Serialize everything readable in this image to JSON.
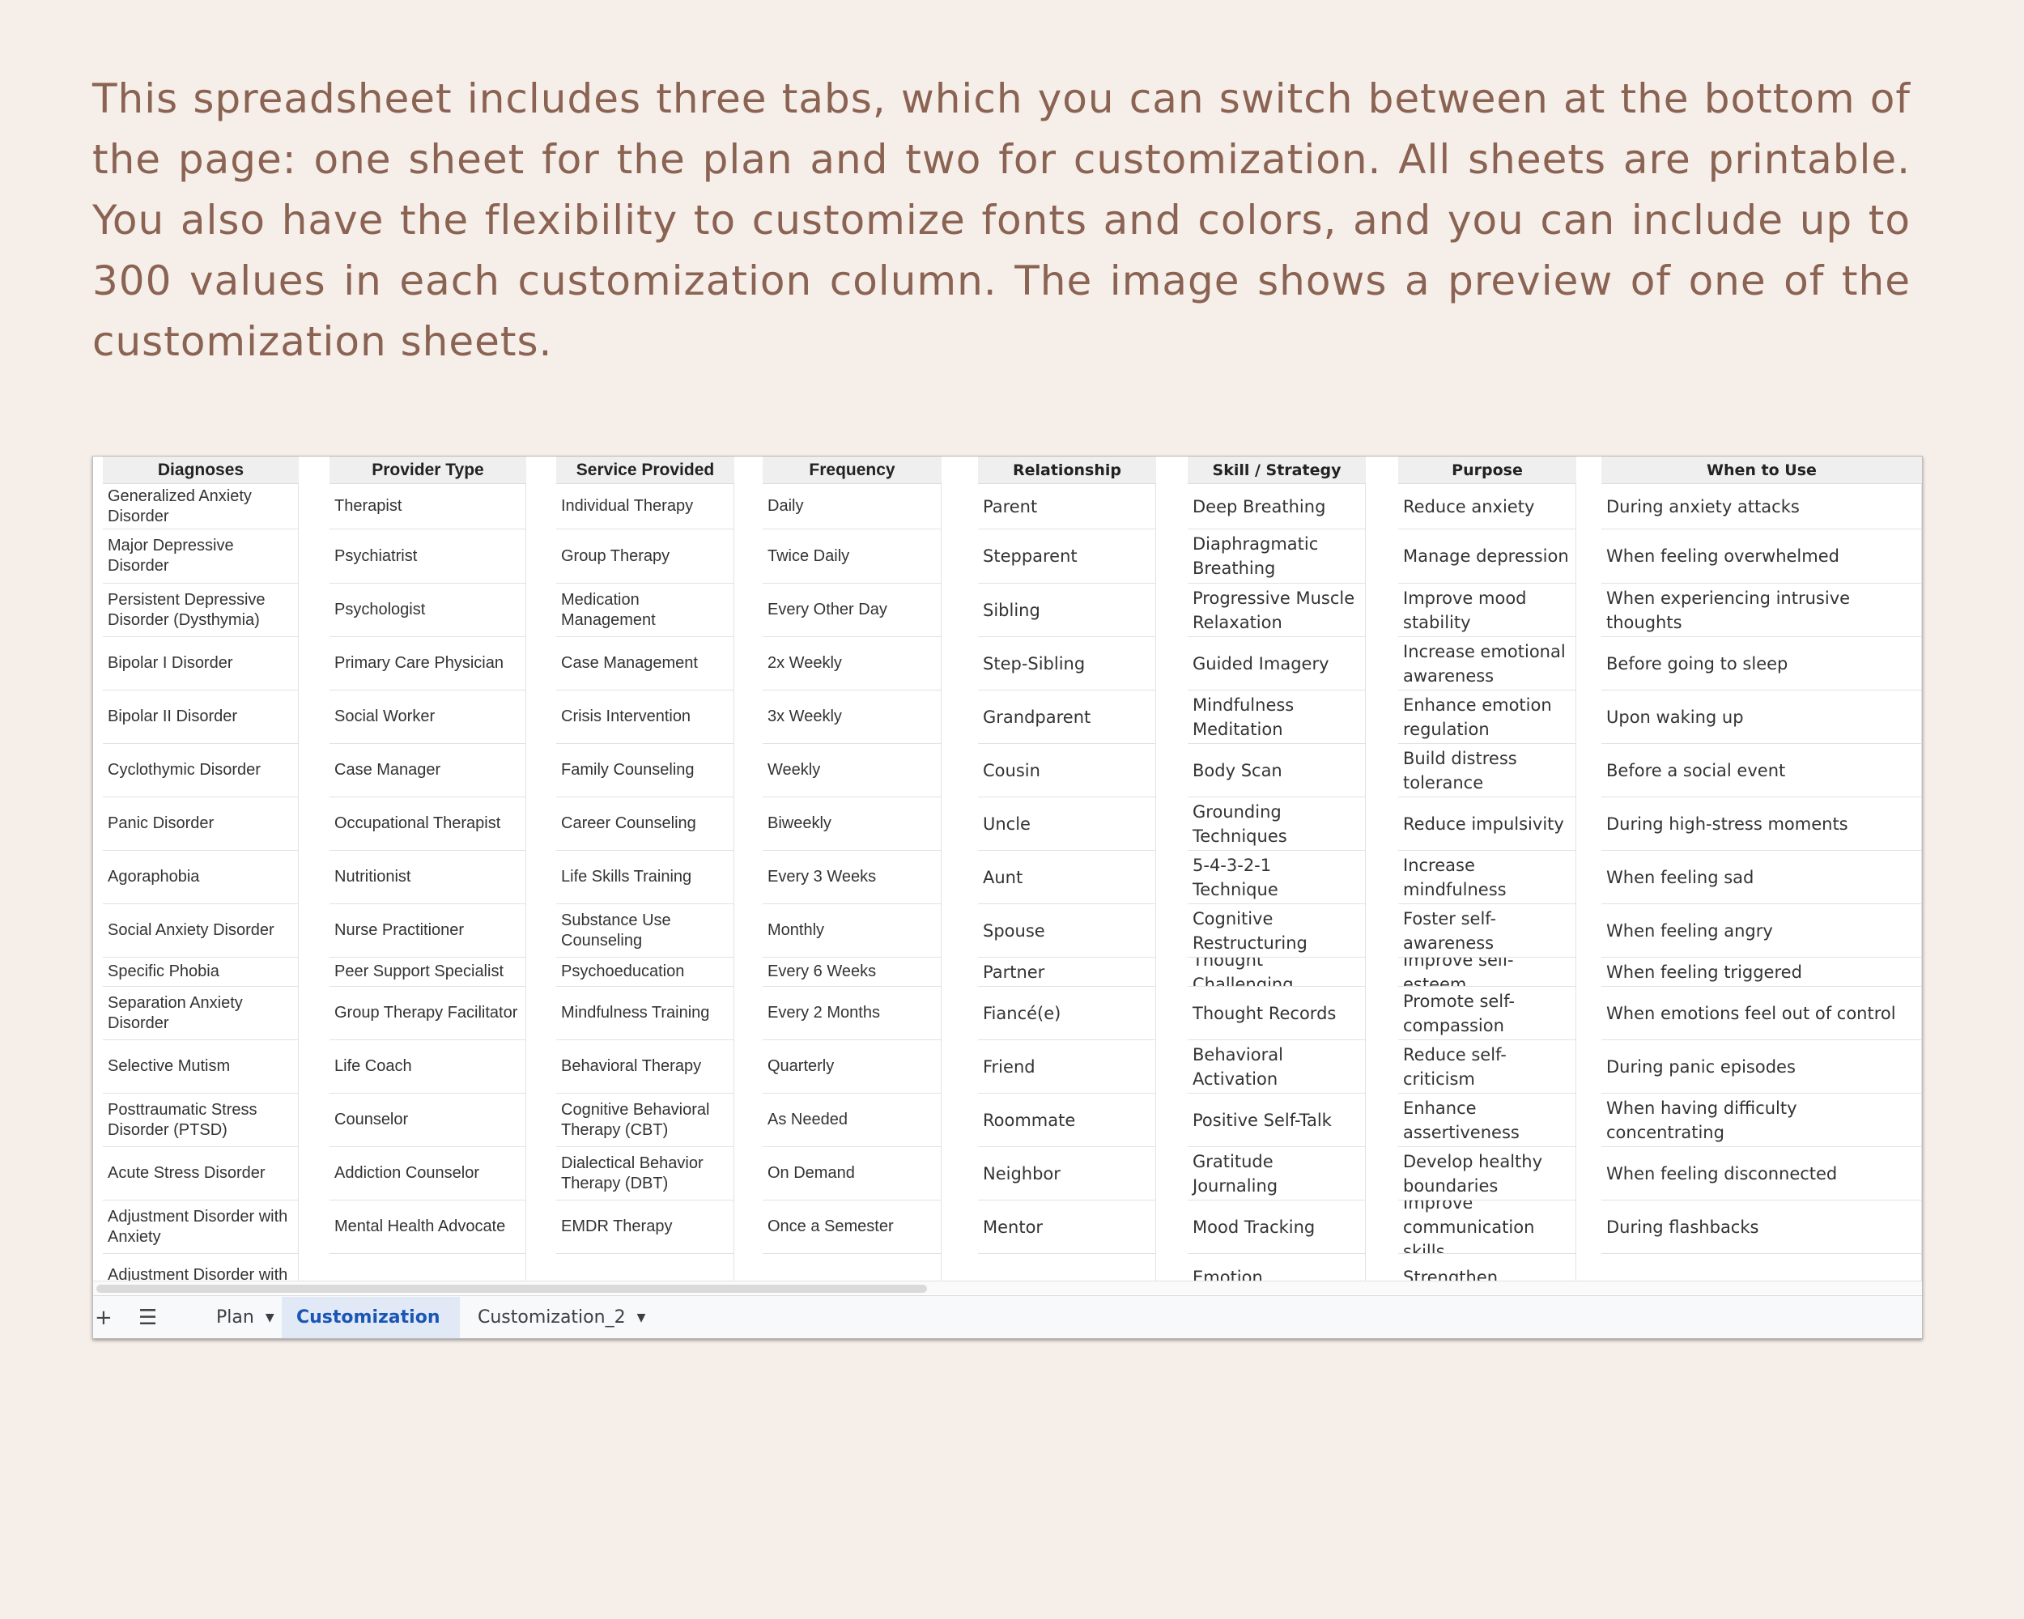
{
  "intro_text": "This spreadsheet includes three tabs, which you can switch between at the bottom of the page: one sheet for the plan and two for customization. All sheets are printable. You also have the flexibility to customize fonts and colors, and you can include up to 300 values in each customization column. The image shows a preview of one of the customization sheets.",
  "columns": [
    {
      "header": "Diagnoses",
      "values": [
        "Generalized Anxiety Disorder",
        "Major Depressive Disorder",
        "Persistent Depressive Disorder (Dysthymia)",
        "Bipolar I Disorder",
        "Bipolar II Disorder",
        "Cyclothymic Disorder",
        "Panic Disorder",
        "Agoraphobia",
        "Social Anxiety Disorder",
        "Specific Phobia",
        "Separation Anxiety Disorder",
        "Selective Mutism",
        "Posttraumatic Stress Disorder (PTSD)",
        "Acute Stress Disorder",
        "Adjustment Disorder with Anxiety",
        "Adjustment Disorder with"
      ]
    },
    {
      "header": "Provider Type",
      "values": [
        "Therapist",
        "Psychiatrist",
        "Psychologist",
        "Primary Care Physician",
        "Social Worker",
        "Case Manager",
        "Occupational Therapist",
        "Nutritionist",
        "Nurse Practitioner",
        "Peer Support Specialist",
        "Group Therapy Facilitator",
        "Life Coach",
        "Counselor",
        "Addiction Counselor",
        "Mental Health Advocate",
        ""
      ]
    },
    {
      "header": "Service Provided",
      "values": [
        "Individual Therapy",
        "Group Therapy",
        "Medication Management",
        "Case Management",
        "Crisis Intervention",
        "Family Counseling",
        "Career Counseling",
        "Life Skills Training",
        "Substance Use Counseling",
        "Psychoeducation",
        "Mindfulness Training",
        "Behavioral Therapy",
        "Cognitive Behavioral Therapy (CBT)",
        "Dialectical Behavior Therapy (DBT)",
        "EMDR Therapy",
        ""
      ]
    },
    {
      "header": "Frequency",
      "values": [
        "Daily",
        "Twice Daily",
        "Every Other Day",
        "2x Weekly",
        "3x Weekly",
        "Weekly",
        "Biweekly",
        "Every 3 Weeks",
        "Monthly",
        "Every 6 Weeks",
        "Every 2 Months",
        "Quarterly",
        "As Needed",
        "On Demand",
        "Once a Semester",
        ""
      ]
    },
    {
      "header": "Relationship",
      "values": [
        "Parent",
        "Stepparent",
        "Sibling",
        "Step-Sibling",
        "Grandparent",
        "Cousin",
        "Uncle",
        "Aunt",
        "Spouse",
        "Partner",
        "Fiancé(e)",
        "Friend",
        "Roommate",
        "Neighbor",
        "Mentor",
        ""
      ]
    },
    {
      "header": "Skill / Strategy",
      "values": [
        "Deep Breathing",
        "Diaphragmatic Breathing",
        "Progressive Muscle Relaxation",
        "Guided Imagery",
        "Mindfulness Meditation",
        "Body Scan",
        "Grounding Techniques",
        "5-4-3-2-1 Technique",
        "Cognitive Restructuring",
        "Thought Challenging",
        "Thought Records",
        "Behavioral Activation",
        "Positive Self-Talk",
        "Gratitude Journaling",
        "Mood Tracking",
        "Emotion"
      ]
    },
    {
      "header": "Purpose",
      "values": [
        "Reduce anxiety",
        "Manage depression",
        "Improve mood stability",
        "Increase emotional awareness",
        "Enhance emotion regulation",
        "Build distress tolerance",
        "Reduce impulsivity",
        "Increase mindfulness",
        "Foster self-awareness",
        "Improve self-esteem",
        "Promote self-compassion",
        "Reduce self-criticism",
        "Enhance assertiveness",
        "Develop healthy boundaries",
        "Improve communication skills",
        "Strengthen"
      ]
    },
    {
      "header": "When to Use",
      "values": [
        "During anxiety attacks",
        "When feeling overwhelmed",
        "When experiencing intrusive thoughts",
        "Before going to sleep",
        "Upon waking up",
        "Before a social event",
        "During high-stress moments",
        "When feeling sad",
        "When feeling angry",
        "When feeling triggered",
        "When emotions feel out of control",
        "During panic episodes",
        "When having difficulty concentrating",
        "When feeling disconnected",
        "During flashbacks",
        ""
      ]
    }
  ],
  "tabs": [
    {
      "label": "Plan",
      "active": false
    },
    {
      "label": "Customization",
      "active": true
    },
    {
      "label": "Customization_2",
      "active": false
    }
  ],
  "toolbar": {
    "add_icon": "plus-icon",
    "menu_icon": "hamburger-icon"
  }
}
